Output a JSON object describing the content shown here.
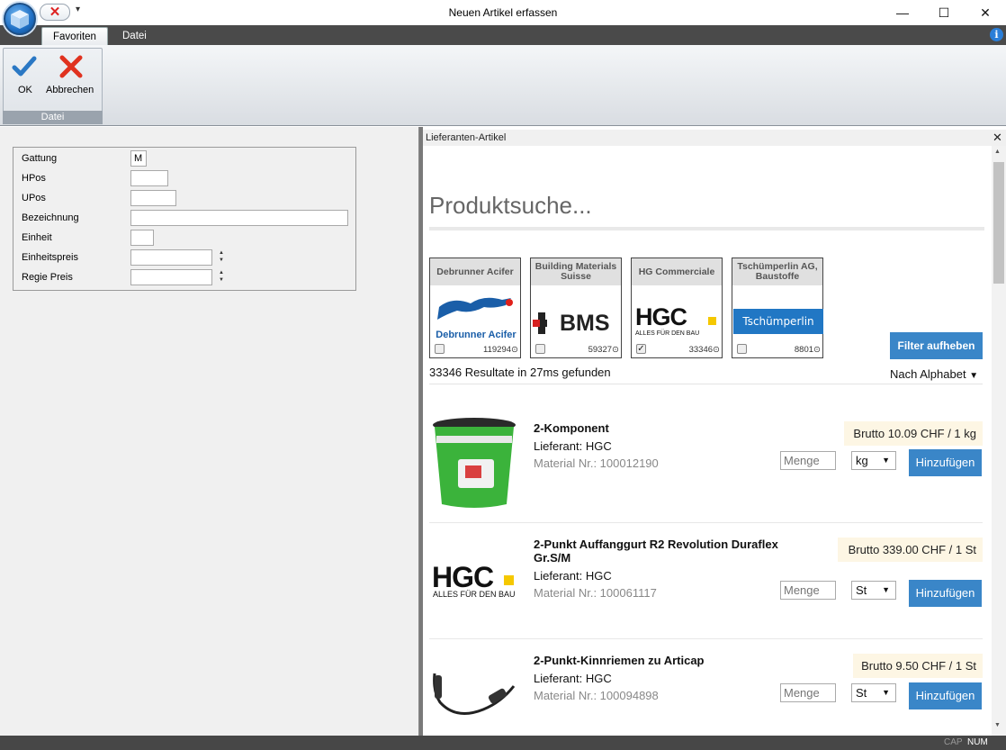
{
  "window": {
    "title": "Neuen Artikel erfassen",
    "minimize": "—",
    "maximize": "☐",
    "close": "✕"
  },
  "qat": {
    "close_glyph": "✕",
    "menu_glyph": "▾"
  },
  "ribbon": {
    "tabs": [
      {
        "label": "Favoriten"
      },
      {
        "label": "Datei"
      }
    ],
    "buttons": [
      {
        "label": "OK"
      },
      {
        "label": "Abbrechen"
      }
    ],
    "group_label": "Datei",
    "info": "i"
  },
  "form": {
    "fields": [
      {
        "label": "Gattung",
        "value": "M"
      },
      {
        "label": "HPos",
        "value": ""
      },
      {
        "label": "UPos",
        "value": ""
      },
      {
        "label": "Bezeichnung",
        "value": ""
      },
      {
        "label": "Einheit",
        "value": ""
      },
      {
        "label": "Einheitspreis",
        "value": ""
      },
      {
        "label": "Regie Preis",
        "value": ""
      }
    ]
  },
  "panel": {
    "title": "Lieferanten-Artikel",
    "close": "✕"
  },
  "search": {
    "heading": "Produktsuche..."
  },
  "suppliers": [
    {
      "name": "Debrunner Acifer",
      "count": "119294",
      "checked": false,
      "logo_text": "Debrunner Acifer"
    },
    {
      "name": "Building Materials Suisse",
      "count": "59327",
      "checked": false,
      "logo_text": "BMS"
    },
    {
      "name": "HG Commerciale",
      "count": "33346",
      "checked": true,
      "logo_text": "HGC",
      "logo_sub": "ALLES FÜR DEN BAU"
    },
    {
      "name": "Tschümperlin AG, Baustoffe",
      "count": "8801",
      "checked": false,
      "logo_text": "Tschümperlin"
    }
  ],
  "filter_button": "Filter aufheben",
  "results": {
    "text": "33346 Resultate in 27ms gefunden",
    "sort": "Nach Alphabet"
  },
  "products": [
    {
      "name": "2-Komponent",
      "supplier": "Lieferant: HGC",
      "material": "Material Nr.: 100012190",
      "price": "Brutto 10.09 CHF / 1 kg",
      "qty_placeholder": "Menge",
      "unit": "kg",
      "add": "Hinzufügen"
    },
    {
      "name": "2-Punkt Auffanggurt R2 Revolution Duraflex Gr.S/M",
      "supplier": "Lieferant: HGC",
      "material": "Material Nr.: 100061117",
      "price": "Brutto 339.00 CHF / 1 St",
      "qty_placeholder": "Menge",
      "unit": "St",
      "add": "Hinzufügen",
      "logo_text": "HGC",
      "logo_sub": "ALLES FÜR DEN BAU"
    },
    {
      "name": "2-Punkt-Kinnriemen zu Articap",
      "supplier": "Lieferant: HGC",
      "material": "Material Nr.: 100094898",
      "price": "Brutto 9.50 CHF / 1 St",
      "qty_placeholder": "Menge",
      "unit": "St",
      "add": "Hinzufügen"
    }
  ],
  "status": {
    "cap": "CAP",
    "num": "NUM"
  },
  "colors": {
    "accent": "#3a86c8",
    "price_bg": "#fdf6e4",
    "ribbon_dark": "#4a4a4a"
  }
}
